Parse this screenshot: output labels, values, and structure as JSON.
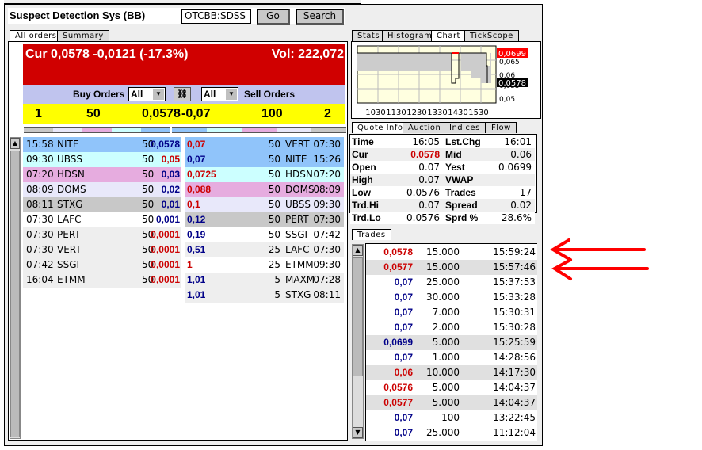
{
  "header": {
    "title": "Suspect Detection Sys (BB)",
    "symbol": "OTCBB:SDSS",
    "go": "Go",
    "search": "Search"
  },
  "left_tabs": [
    "All orders",
    "Summary"
  ],
  "banner": {
    "cur": "Cur 0,0578 -0,0121 (-17.3%)",
    "vol": "Vol: 222,072"
  },
  "filters": {
    "buy_label": "Buy Orders",
    "buy_value": "All",
    "sell_label": "Sell Orders",
    "sell_value": "All",
    "link_icon": "link-icon"
  },
  "summary": {
    "buy_count": "1",
    "buy_size": "50",
    "bid": "0,0578",
    "ask": "-0,07",
    "sell_size": "100",
    "sell_count": "2"
  },
  "colors": {
    "blue": "#90c4fa",
    "cyan": "#ccffff",
    "pink": "#e6acdf",
    "lavender": "#e8e8fa",
    "gray": "#c8c8c8",
    "white": "#ffffff",
    "light": "#eeeeee",
    "red": "#cc0000",
    "navy": "#000080",
    "yellow": "#ffff00",
    "banner": "#d00000"
  },
  "buy_orders": [
    {
      "time": "15:58",
      "mm": "NITE",
      "size": "50",
      "price": "0,0578",
      "pc": "blue",
      "bg": "blue"
    },
    {
      "time": "09:30",
      "mm": "UBSS",
      "size": "50",
      "price": "0,05",
      "pc": "red",
      "bg": "cyan"
    },
    {
      "time": "07:20",
      "mm": "HDSN",
      "size": "50",
      "price": "0,03",
      "pc": "blue",
      "bg": "pink"
    },
    {
      "time": "08:09",
      "mm": "DOMS",
      "size": "50",
      "price": "0,02",
      "pc": "blue",
      "bg": "lavender"
    },
    {
      "time": "08:11",
      "mm": "STXG",
      "size": "50",
      "price": "0,01",
      "pc": "blue",
      "bg": "gray"
    },
    {
      "time": "07:30",
      "mm": "LAFC",
      "size": "50",
      "price": "0,001",
      "pc": "blue",
      "bg": "white"
    },
    {
      "time": "07:30",
      "mm": "PERT",
      "size": "50",
      "price": "0,0001",
      "pc": "red",
      "bg": "light"
    },
    {
      "time": "07:30",
      "mm": "VERT",
      "size": "50",
      "price": "0,0001",
      "pc": "red",
      "bg": "light"
    },
    {
      "time": "07:42",
      "mm": "SSGI",
      "size": "50",
      "price": "0,0001",
      "pc": "red",
      "bg": "light"
    },
    {
      "time": "16:04",
      "mm": "ETMM",
      "size": "50",
      "price": "0,0001",
      "pc": "red",
      "bg": "light"
    }
  ],
  "sell_orders": [
    {
      "price": "0,07",
      "size": "50",
      "mm": "VERT",
      "time": "07:30",
      "pc": "red",
      "bg": "blue"
    },
    {
      "price": "0,07",
      "size": "50",
      "mm": "NITE",
      "time": "15:26",
      "pc": "blue",
      "bg": "blue"
    },
    {
      "price": "0,0725",
      "size": "50",
      "mm": "HDSN",
      "time": "07:20",
      "pc": "red",
      "bg": "cyan"
    },
    {
      "price": "0,088",
      "size": "50",
      "mm": "DOMS",
      "time": "08:09",
      "pc": "red",
      "bg": "pink"
    },
    {
      "price": "0,1",
      "size": "50",
      "mm": "UBSS",
      "time": "09:30",
      "pc": "red",
      "bg": "lavender"
    },
    {
      "price": "0,12",
      "size": "50",
      "mm": "PERT",
      "time": "07:30",
      "pc": "blue",
      "bg": "gray"
    },
    {
      "price": "0,19",
      "size": "50",
      "mm": "SSGI",
      "time": "07:42",
      "pc": "blue",
      "bg": "white"
    },
    {
      "price": "0,51",
      "size": "25",
      "mm": "LAFC",
      "time": "07:30",
      "pc": "blue",
      "bg": "light"
    },
    {
      "price": "1",
      "size": "25",
      "mm": "ETMM",
      "time": "09:30",
      "pc": "red",
      "bg": "white"
    },
    {
      "price": "1,01",
      "size": "5",
      "mm": "MAXM",
      "time": "07:28",
      "pc": "blue",
      "bg": "light"
    },
    {
      "price": "1,01",
      "size": "5",
      "mm": "STXG",
      "time": "08:11",
      "pc": "blue",
      "bg": "light"
    }
  ],
  "right_tabs": [
    "Stats",
    "Histogram",
    "Chart",
    "TickScope"
  ],
  "chart": {
    "x_ticks": [
      "1030",
      "1130",
      "1230",
      "1330",
      "1430",
      "1530"
    ],
    "y_ticks": [
      "0,065",
      "0,06",
      "0,055",
      "0,05"
    ],
    "high_label": "0,0699",
    "cur_label": "0,0578"
  },
  "quote_tabs": [
    "Quote Info",
    "Auction",
    "Indices",
    "Flow"
  ],
  "quote": [
    {
      "l1": "Time",
      "v1": "16:05",
      "l2": "Lst.Chg",
      "v2": "16:01"
    },
    {
      "l1": "Cur",
      "v1": "0.0578",
      "l2": "Mid",
      "v2": "0.06"
    },
    {
      "l1": "Open",
      "v1": "0.07",
      "l2": "Yest",
      "v2": "0.0699"
    },
    {
      "l1": "High",
      "v1": "0.07",
      "l2": "VWAP",
      "v2": ""
    },
    {
      "l1": "Low",
      "v1": "0.0576",
      "l2": "Trades",
      "v2": "17"
    },
    {
      "l1": "Trd.Hi",
      "v1": "0.07",
      "l2": "Spread",
      "v2": "0.02"
    },
    {
      "l1": "Trd.Lo",
      "v1": "0.0576",
      "l2": "Sprd %",
      "v2": "28.6%"
    }
  ],
  "trades_tab": "Trades",
  "trades": [
    {
      "price": "0,0578",
      "size": "15.000",
      "time": "15:59:24",
      "pc": "red",
      "bg": "white"
    },
    {
      "price": "0,0577",
      "size": "15.000",
      "time": "15:57:46",
      "pc": "red",
      "bg": "gray"
    },
    {
      "price": "0,07",
      "size": "25.000",
      "time": "15:37:53",
      "pc": "blue",
      "bg": "white"
    },
    {
      "price": "0,07",
      "size": "30.000",
      "time": "15:33:28",
      "pc": "blue",
      "bg": "white"
    },
    {
      "price": "0,07",
      "size": "7.000",
      "time": "15:30:31",
      "pc": "blue",
      "bg": "white"
    },
    {
      "price": "0,07",
      "size": "2.000",
      "time": "15:30:28",
      "pc": "blue",
      "bg": "white"
    },
    {
      "price": "0,0699",
      "size": "5.000",
      "time": "15:25:59",
      "pc": "blue",
      "bg": "gray"
    },
    {
      "price": "0,07",
      "size": "1.000",
      "time": "14:28:56",
      "pc": "blue",
      "bg": "white"
    },
    {
      "price": "0,06",
      "size": "10.000",
      "time": "14:17:30",
      "pc": "red",
      "bg": "gray"
    },
    {
      "price": "0,0576",
      "size": "5.000",
      "time": "14:04:37",
      "pc": "red",
      "bg": "white"
    },
    {
      "price": "0,0577",
      "size": "5.000",
      "time": "14:04:37",
      "pc": "red",
      "bg": "gray"
    },
    {
      "price": "0,07",
      "size": "100",
      "time": "13:22:45",
      "pc": "blue",
      "bg": "white"
    },
    {
      "price": "0,07",
      "size": "25.000",
      "time": "11:12:04",
      "pc": "blue",
      "bg": "white"
    }
  ]
}
